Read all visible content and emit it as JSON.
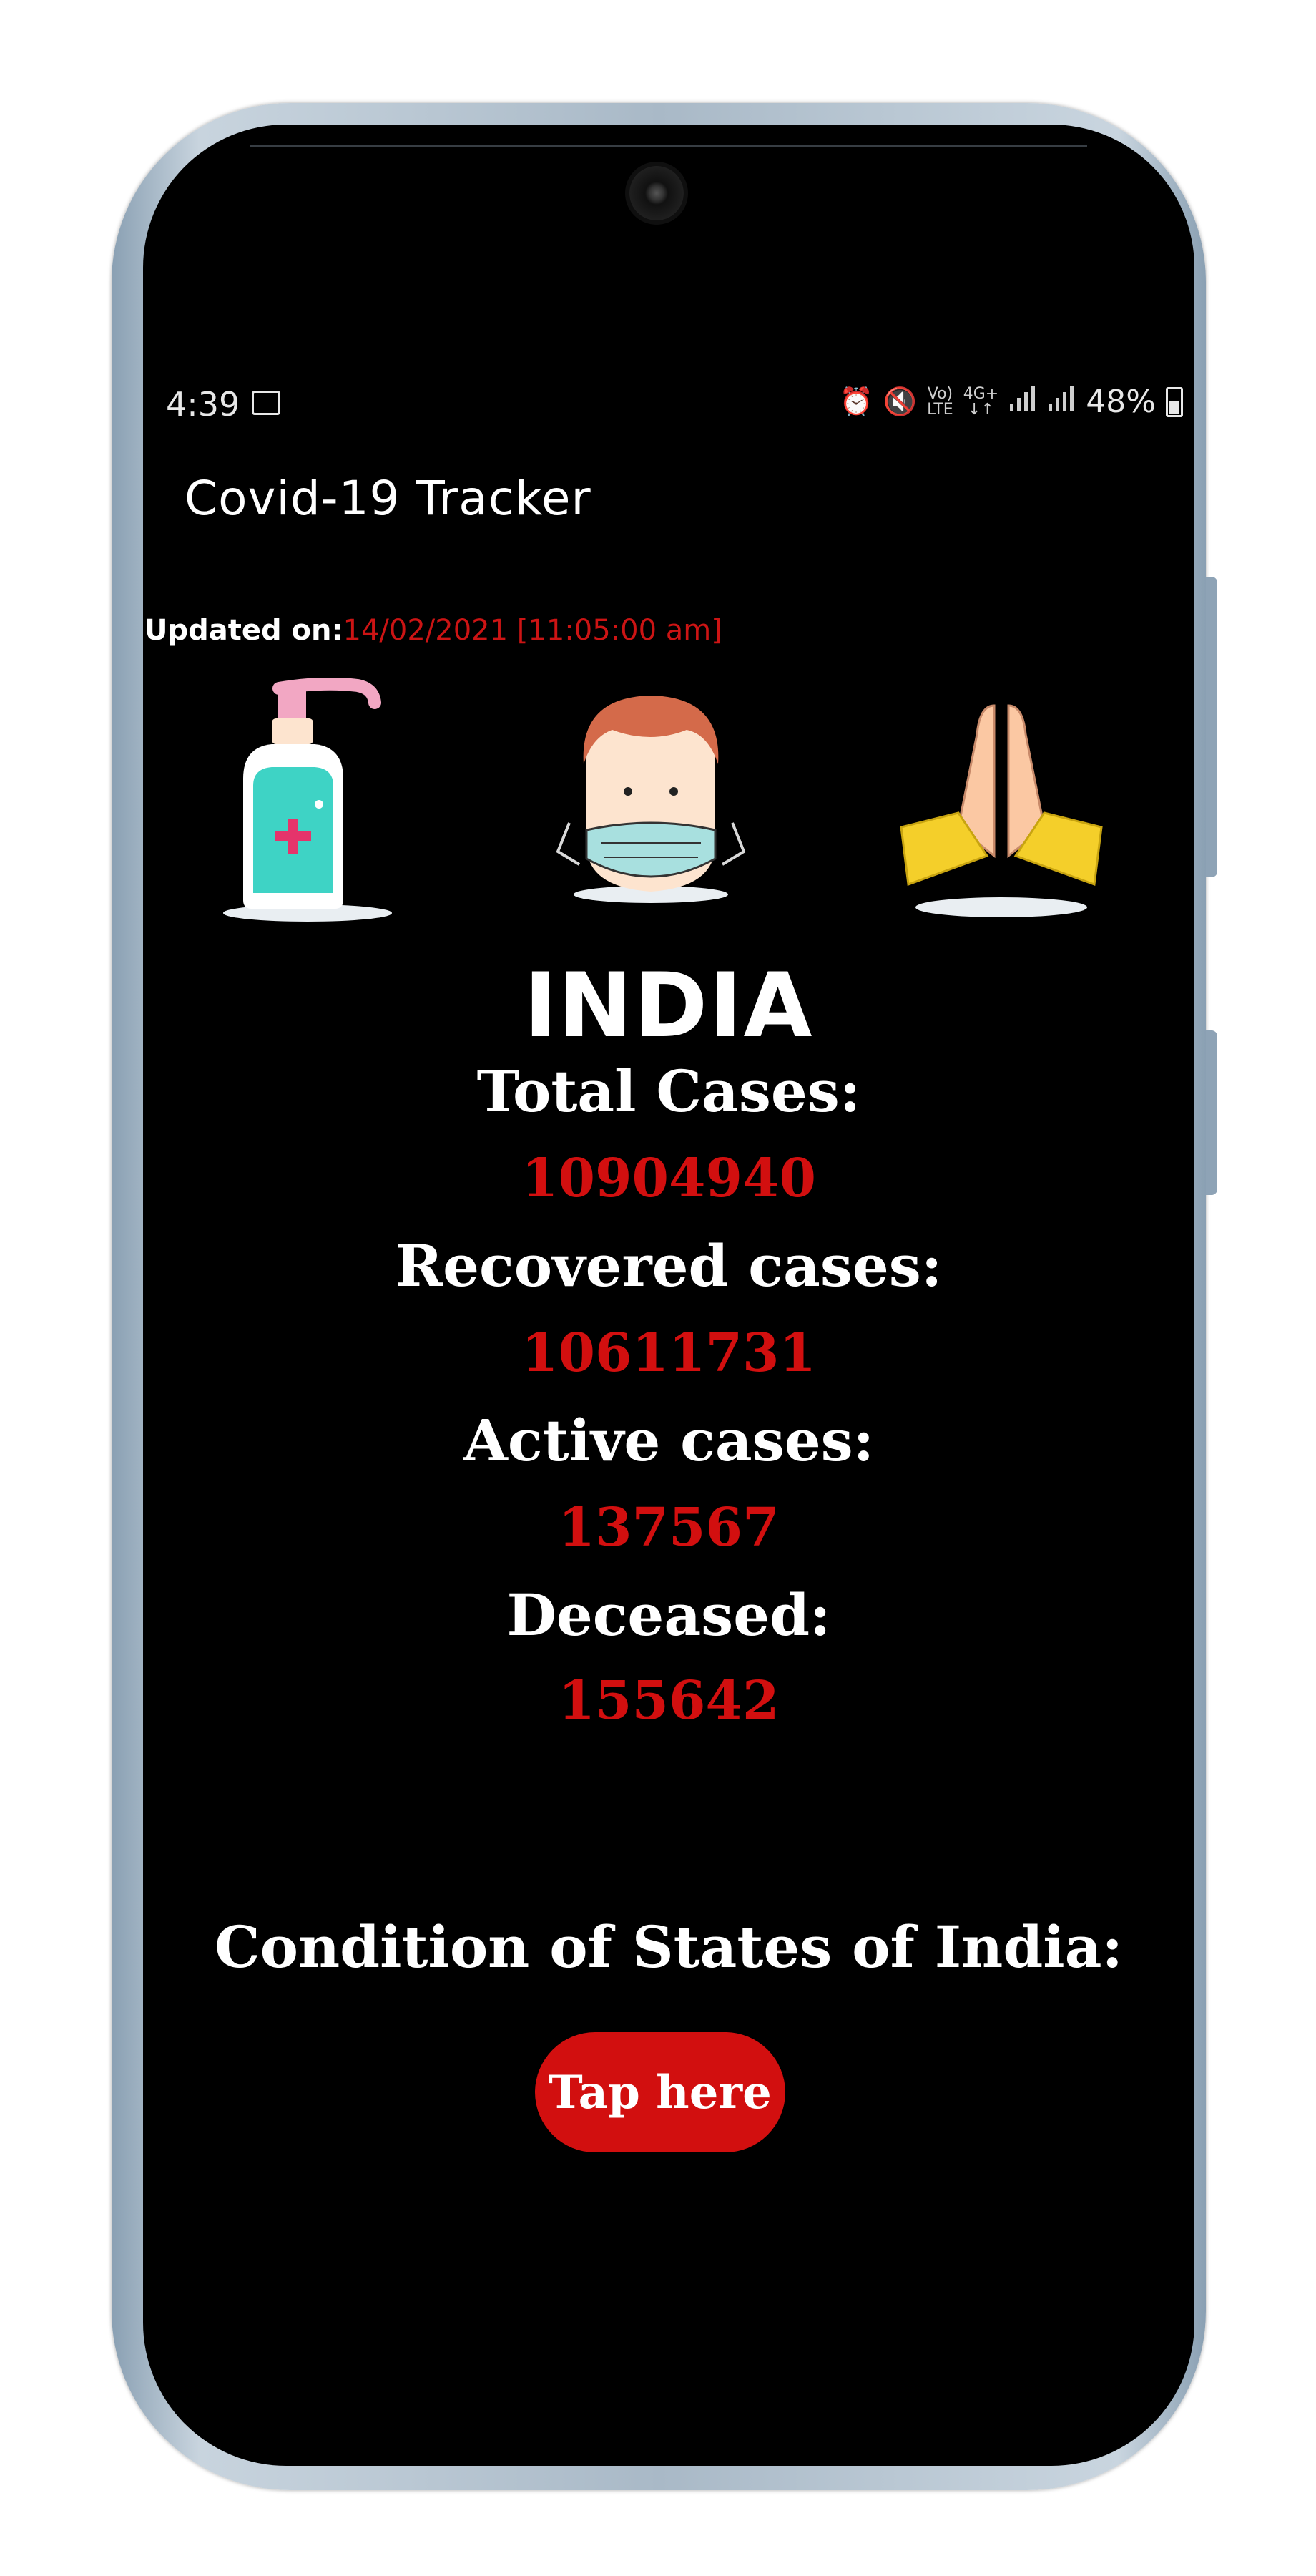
{
  "status_bar": {
    "time": "4:39",
    "signal_small_top": "Vo)",
    "signal_small_bottom": "LTE",
    "network_top": "4G+",
    "network_bottom": "↓↑",
    "battery": "48%"
  },
  "app": {
    "title": "Covid-19 Tracker",
    "updated_label": "Updated on:",
    "updated_value": "14/02/2021 [11:05:00 am]",
    "country": "INDIA"
  },
  "stats": {
    "total_label": "Total Cases:",
    "total_value": "10904940",
    "recovered_label": "Recovered cases:",
    "recovered_value": "10611731",
    "active_label": "Active cases:",
    "active_value": "137567",
    "deceased_label": "Deceased:",
    "deceased_value": "155642"
  },
  "states": {
    "title": "Condition of States of India:",
    "button_label": "Tap here"
  },
  "colors": {
    "background": "#000000",
    "accent_red": "#d20f0f",
    "text": "#ffffff"
  },
  "icons": [
    "sanitizer-icon",
    "masked-man-icon",
    "folded-hands-icon"
  ]
}
